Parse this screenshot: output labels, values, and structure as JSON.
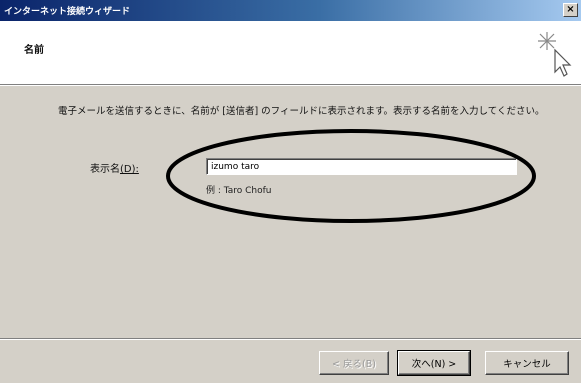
{
  "window": {
    "title": "インターネット接続ウィザード",
    "close_label": "×"
  },
  "header": {
    "title": "名前"
  },
  "body": {
    "description": "電子メールを送信するときに、名前が [送信者] のフィールドに表示されます。表示する名前を入力してください。",
    "field_label": "表示名",
    "field_accesskey": "(D):",
    "input_value": "izumo taro",
    "example": "例 : Taro Chofu"
  },
  "buttons": {
    "back": "< 戻る(B)",
    "next": "次へ(N) >",
    "cancel": "キャンセル"
  }
}
